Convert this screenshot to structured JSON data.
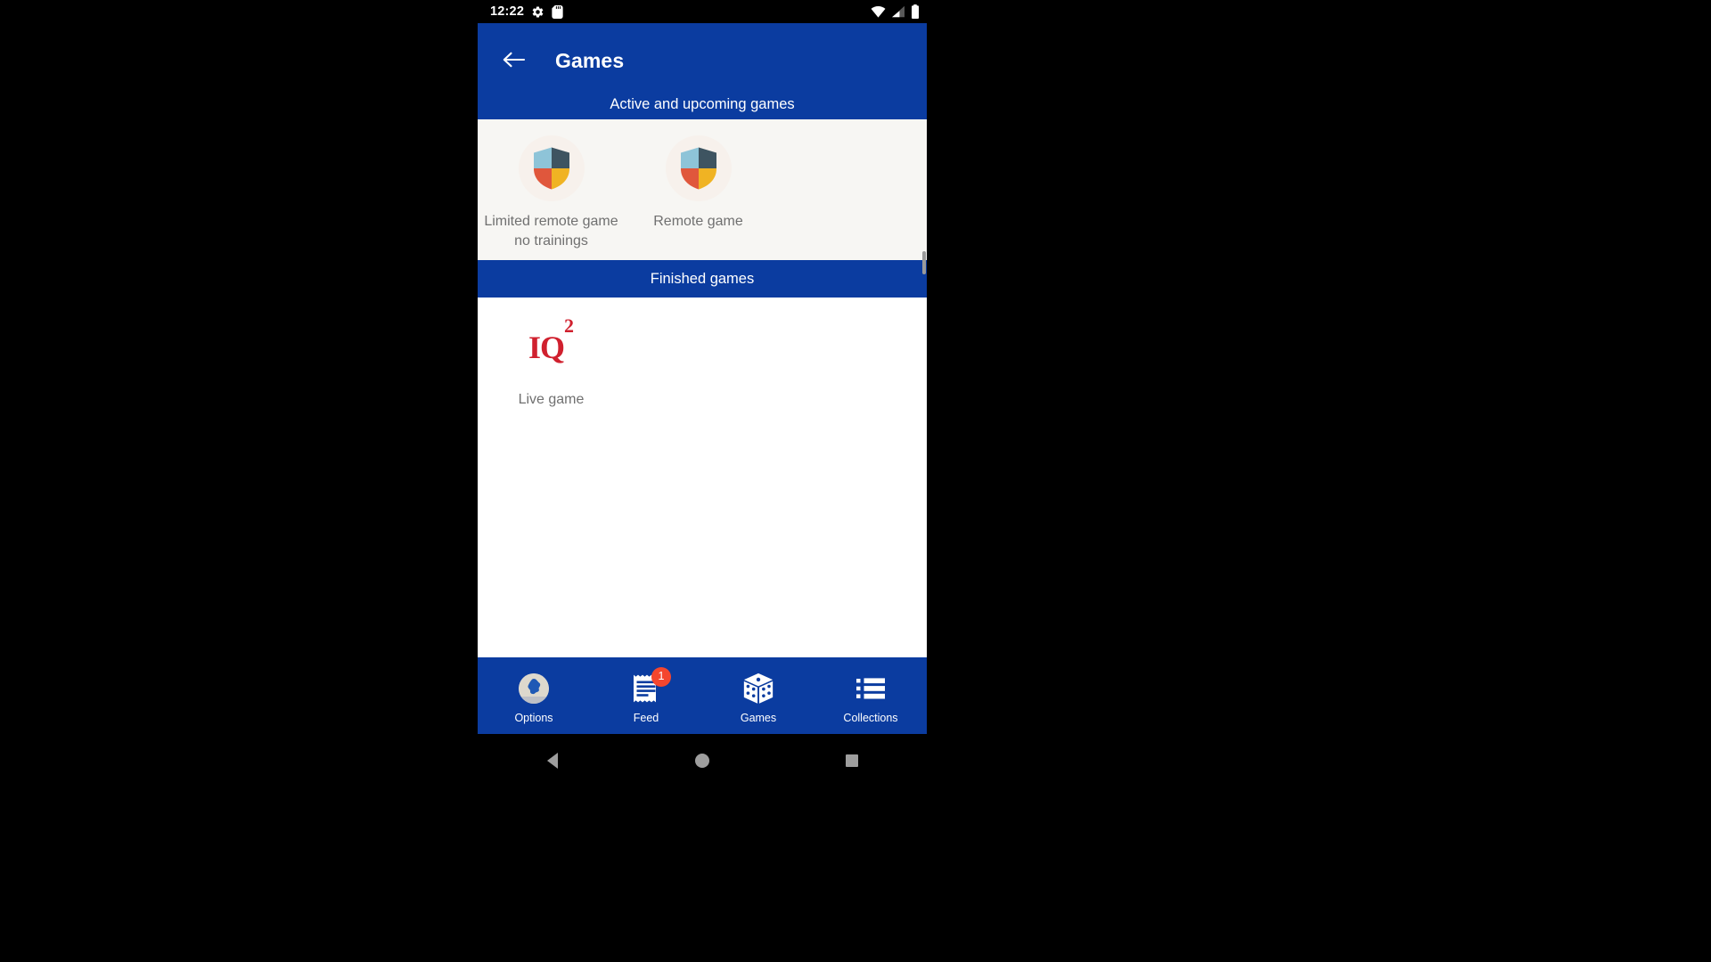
{
  "status_bar": {
    "clock": "12:22",
    "left_icons": [
      "gear-icon",
      "sd-card-icon"
    ],
    "right_icons": [
      "wifi-icon",
      "cell-signal-icon",
      "battery-icon"
    ]
  },
  "app_bar": {
    "back_icon": "back-arrow-icon",
    "title": "Games",
    "background_color": "#0b3ca0"
  },
  "sections": [
    {
      "id": "active",
      "header": "Active and upcoming games",
      "background_color": "#f7f6f3",
      "tiles": [
        {
          "label": "Limited remote game no trainings",
          "icon": "shield-icon",
          "art_style": "cream"
        },
        {
          "label": "Remote game",
          "icon": "shield-icon",
          "art_style": "cream"
        }
      ]
    },
    {
      "id": "finished",
      "header": "Finished games",
      "background_color": "#ffffff",
      "tiles": [
        {
          "label": "Live game",
          "icon": "iq2-logo-icon",
          "logo_text": "IQ",
          "logo_sup": "2",
          "art_style": "white"
        }
      ]
    }
  ],
  "shield_colors": {
    "top_left": "#8ec4d8",
    "top_right": "#3e5461",
    "bottom_left": "#e0573c",
    "bottom_right": "#f0b323",
    "circle_bg": "#f7f1ec"
  },
  "brand_colors": {
    "primary_blue": "#0b3ca0",
    "badge_red": "#f4462e",
    "logo_red": "#d0202e",
    "label_gray": "#707070"
  },
  "bottom_nav": {
    "items": [
      {
        "label": "Options",
        "icon": "avatar-icon",
        "badge": null,
        "selected": false
      },
      {
        "label": "Feed",
        "icon": "receipt-icon",
        "badge": "1",
        "selected": false
      },
      {
        "label": "Games",
        "icon": "dice-icon",
        "badge": null,
        "selected": true
      },
      {
        "label": "Collections",
        "icon": "list-icon",
        "badge": null,
        "selected": false
      }
    ]
  },
  "android_nav": {
    "back": "back-triangle-icon",
    "home": "home-circle-icon",
    "recents": "recents-square-icon"
  }
}
